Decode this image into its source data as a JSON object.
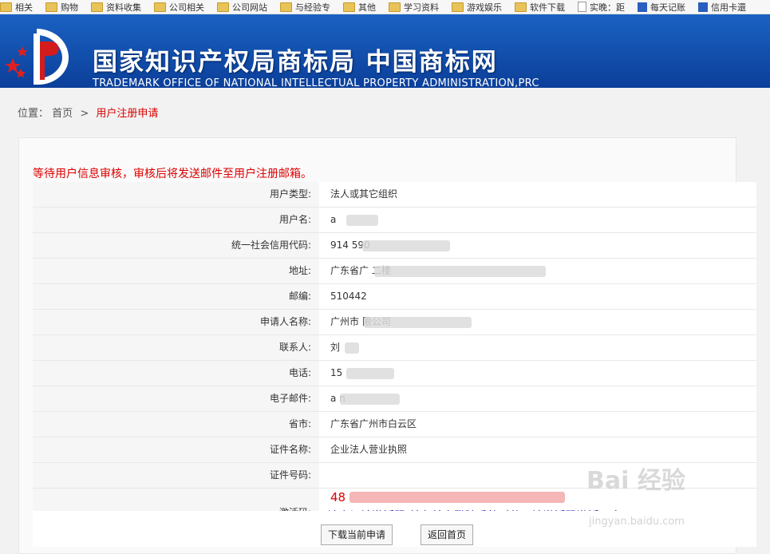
{
  "bookmarks": [
    "相关",
    "购物",
    "资料收集",
    "公司相关",
    "公司网站",
    "与经验专",
    "其他",
    "学习资料",
    "游戏娱乐",
    "软件下载",
    "实晚：距",
    "每天记账",
    "信用卡還"
  ],
  "header": {
    "title_cn": "国家知识产权局商标局 中国商标网",
    "title_en": "TRADEMARK OFFICE OF NATIONAL INTELLECTUAL PROPERTY ADMINISTRATION,PRC"
  },
  "breadcrumb": {
    "prefix": "位置：",
    "home": "首页",
    "sep": ">",
    "current": "用户注册申请"
  },
  "notice": "等待用户信息审核，审核后将发送邮件至用户注册邮箱。",
  "fields": [
    {
      "label": "用户类型:",
      "value": "法人或其它组织"
    },
    {
      "label": "用户名:",
      "value": "a"
    },
    {
      "label": "统一社会信用代码:",
      "value": "914                    590"
    },
    {
      "label": "地址:",
      "value": "广东省广                              二楼"
    },
    {
      "label": "邮编:",
      "value": "510442"
    },
    {
      "label": "申请人名称:",
      "value": "广州市                     限公司"
    },
    {
      "label": "联系人:",
      "value": "刘"
    },
    {
      "label": "电话:",
      "value": "15"
    },
    {
      "label": "电子邮件:",
      "value": "a                 n"
    },
    {
      "label": "省市:",
      "value": "广东省广州市白云区"
    },
    {
      "label": "证件名称:",
      "value": "企业法人营业执照"
    },
    {
      "label": "证件号码:",
      "value": ""
    }
  ],
  "activation": {
    "label": "激活码:",
    "code": "48                                    e7",
    "tip": "(请牢记该激活码,并在首次登陆系统时使用该激活码激活用户)"
  },
  "buttons": {
    "download": "下载当前申请",
    "back": "返回首页"
  },
  "watermark": {
    "main": "Bai 经验",
    "sub": "jingyan.baidu.com"
  }
}
